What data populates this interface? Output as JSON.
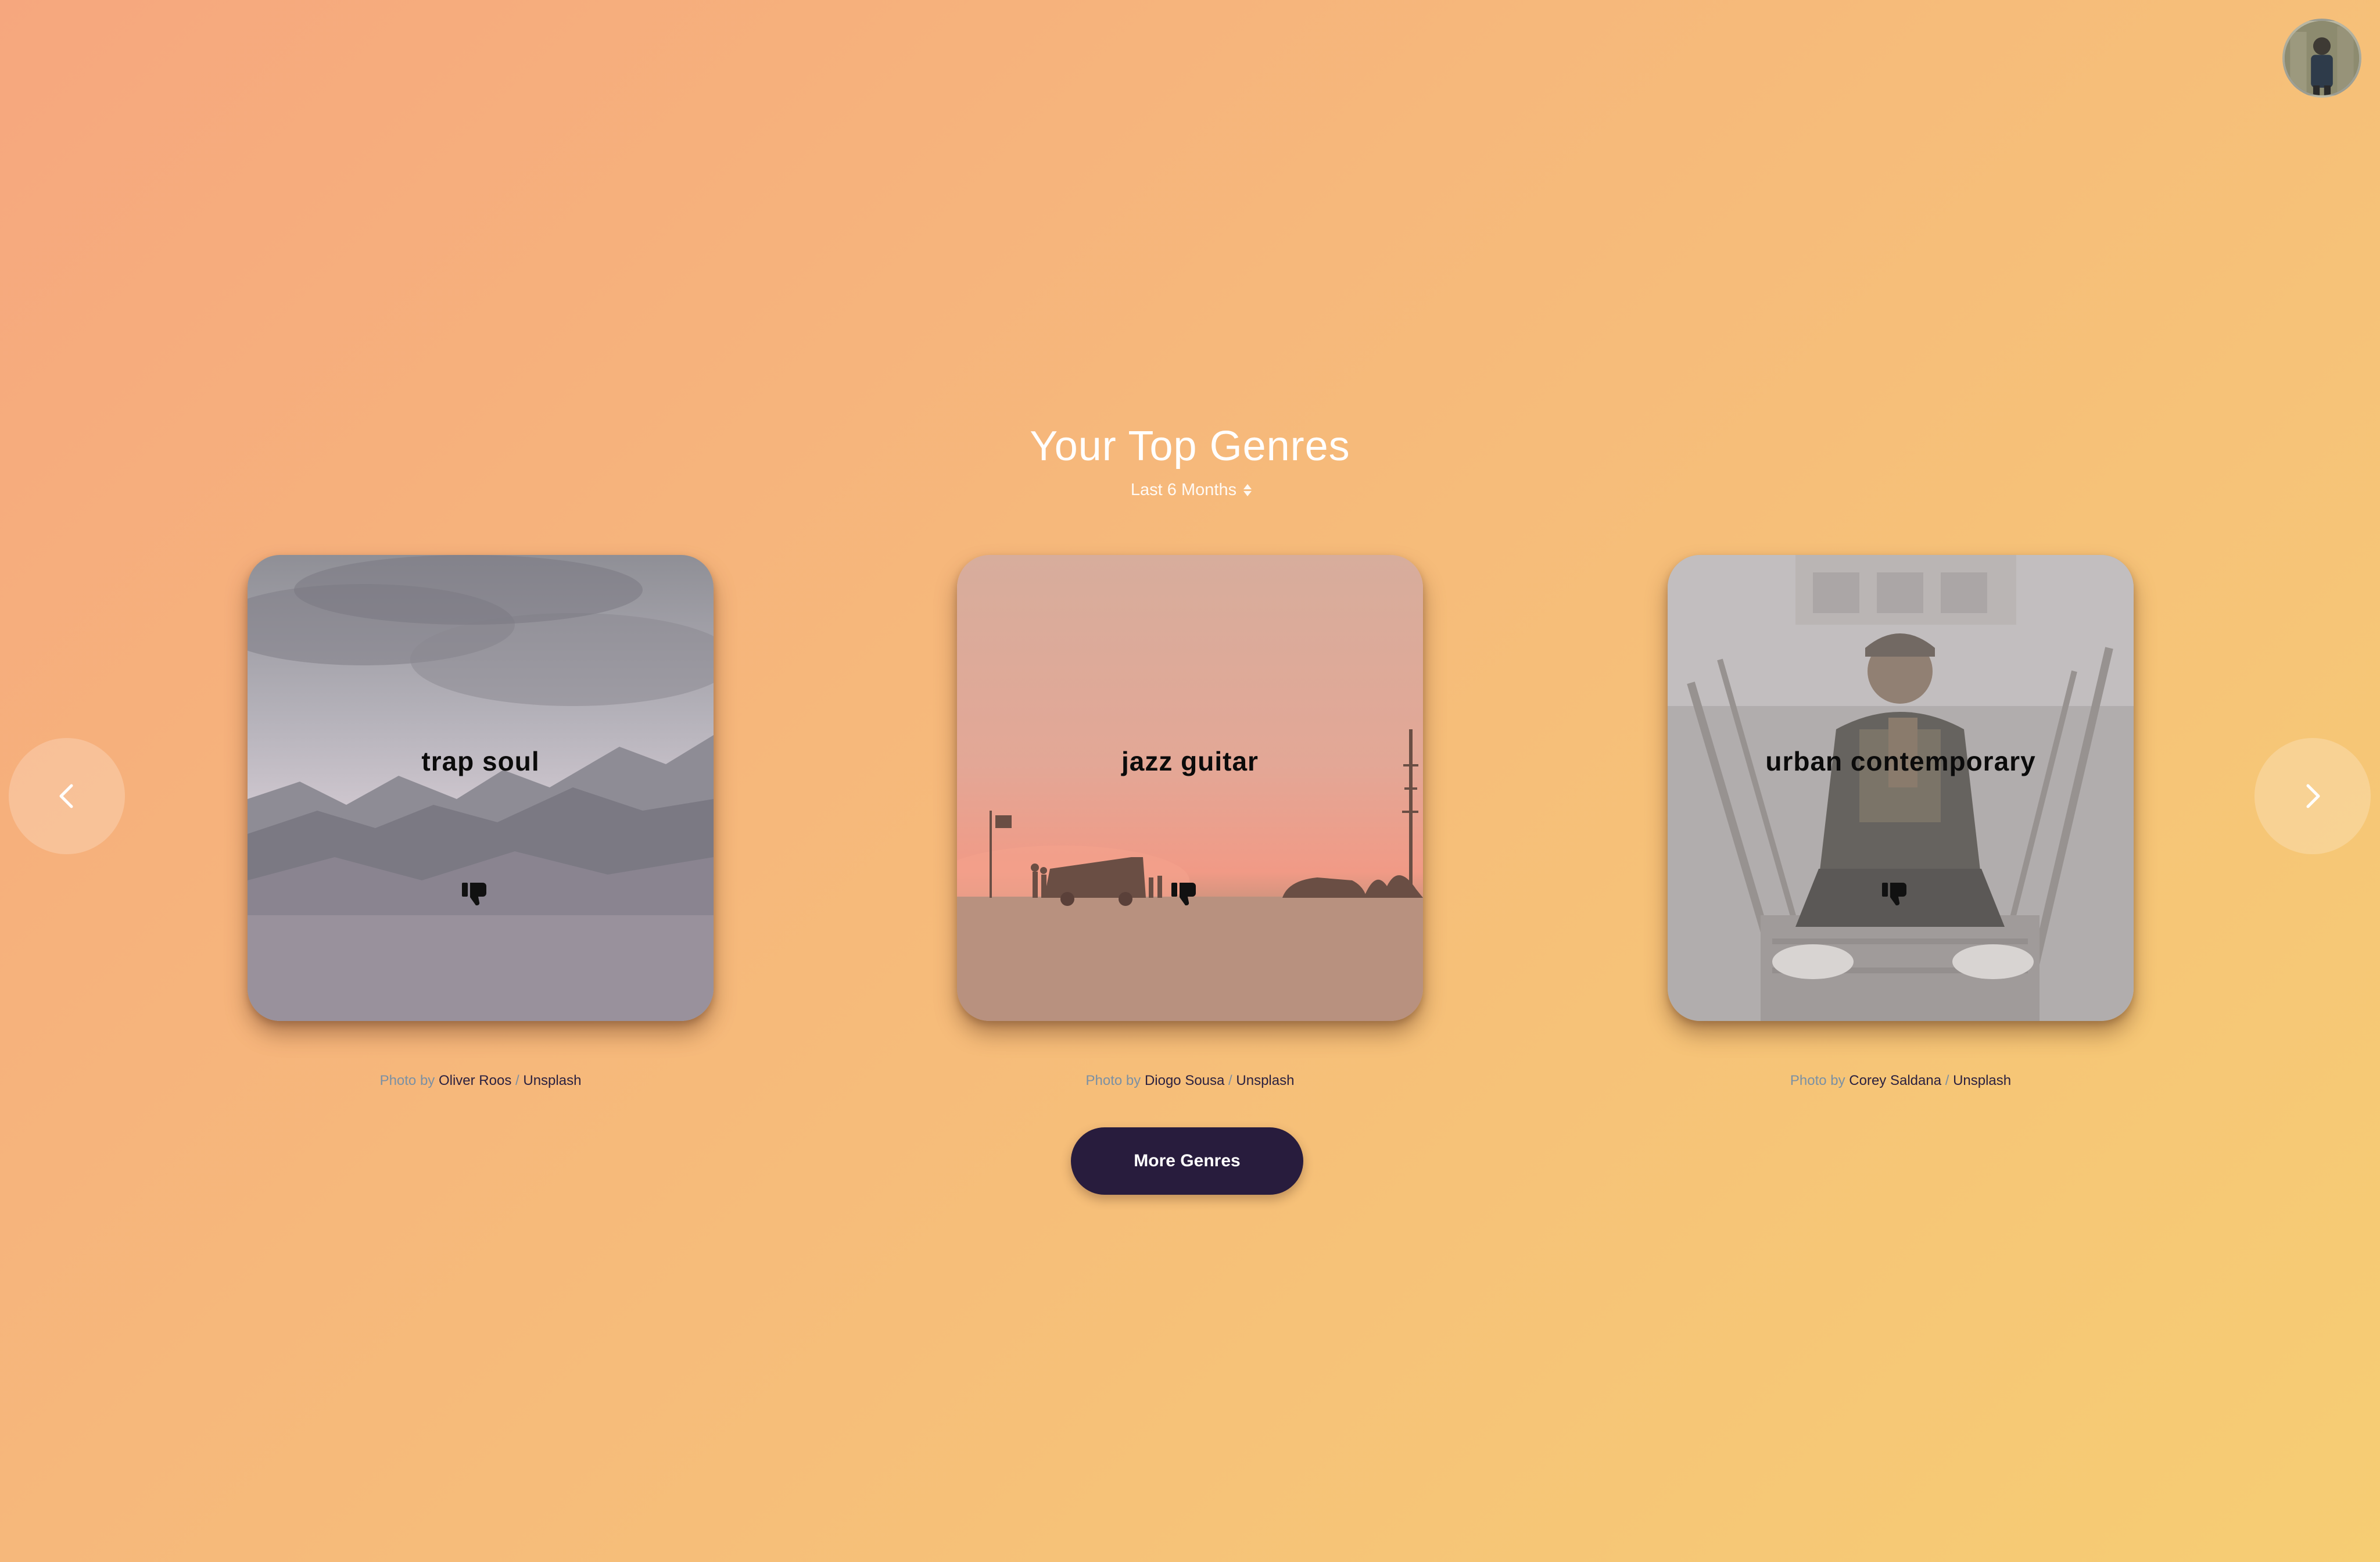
{
  "header": {
    "title": "Your Top Genres",
    "range_label": "Last 6 Months"
  },
  "genres": [
    {
      "name": "trap soul",
      "photo_by_label": "Photo by",
      "author": "Oliver Roos",
      "separator": "/",
      "source": "Unsplash"
    },
    {
      "name": "jazz guitar",
      "photo_by_label": "Photo by",
      "author": "Diogo Sousa",
      "separator": "/",
      "source": "Unsplash"
    },
    {
      "name": "urban contemporary",
      "photo_by_label": "Photo by",
      "author": "Corey Saldana",
      "separator": "/",
      "source": "Unsplash"
    }
  ],
  "actions": {
    "more_label": "More Genres"
  },
  "icons": {
    "prev": "chevron-left-icon",
    "next": "chevron-right-icon",
    "dislike": "thumbs-down-icon",
    "range": "up-down-icon"
  },
  "colors": {
    "button_bg": "#281c3d",
    "link_text": "#2b2140",
    "muted_text": "#7a90a4"
  }
}
